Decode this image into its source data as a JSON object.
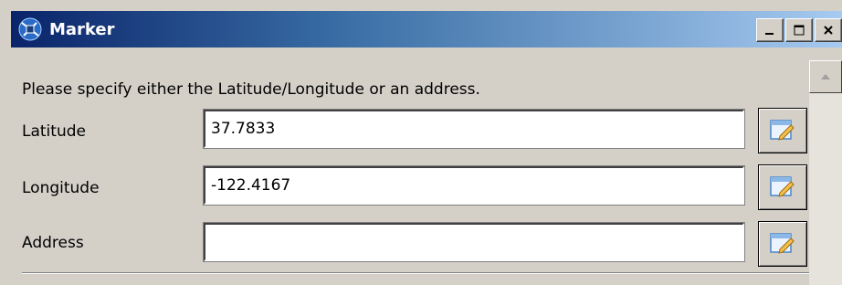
{
  "window": {
    "title": "Marker",
    "icon": "satellite-icon",
    "minimize": "minimize-icon",
    "maximize": "maximize-icon",
    "close": "close-icon"
  },
  "form": {
    "instruction": "Please specify either the Latitude/Longitude or an address.",
    "fields": [
      {
        "label": "Latitude",
        "value": "37.7833",
        "button_icon": "edit-icon"
      },
      {
        "label": "Longitude",
        "value": "-122.4167",
        "button_icon": "edit-icon"
      },
      {
        "label": "Address",
        "value": "",
        "button_icon": "edit-icon"
      }
    ]
  },
  "colors": {
    "titlebar_start": "#0a246a",
    "titlebar_end": "#a6caf0",
    "dialog_bg": "#d4d0c8"
  }
}
